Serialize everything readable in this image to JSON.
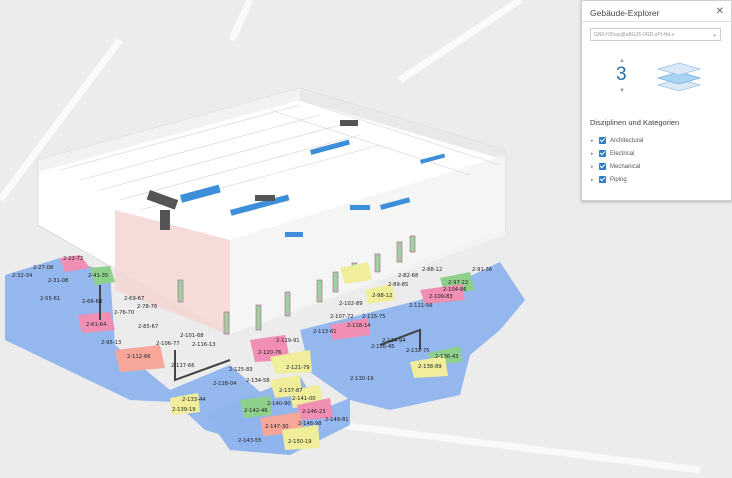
{
  "panel": {
    "title": "Gebäude-Explorer",
    "close_icon": "close-icon",
    "building_select": "GN0-H2hap@aBG35-0GD-zPl-Hd-s",
    "level": "3",
    "level_up_icon": "chevron-up-icon",
    "level_down_icon": "chevron-down-icon",
    "stack_icon": "floor-stack-icon",
    "section_title": "Disziplinen und Kategorien",
    "categories": [
      {
        "label": "Architectural",
        "checked": true
      },
      {
        "label": "Electrical",
        "checked": true
      },
      {
        "label": "Mechanical",
        "checked": true
      },
      {
        "label": "Piping",
        "checked": true
      }
    ]
  },
  "rooms": [
    "2-27-08",
    "2-22-72",
    "2-32-34",
    "2-31-08",
    "2-41-35",
    "2-55-61",
    "2-69-67",
    "2-78-76",
    "2-76-70",
    "2-61-64",
    "2-66-68",
    "2-85-67",
    "2-95-13",
    "2-101-68",
    "2-106-77",
    "2-116-13",
    "2-112-66",
    "2-117-66",
    "2-119-91",
    "2-120-76",
    "2-121-79",
    "2-125-83",
    "2-128-04",
    "2-134-58",
    "2-133-44",
    "2-139-19",
    "2-137-87",
    "2-141-00",
    "2-140-90",
    "2-142-46",
    "2-146-23",
    "2-147-30",
    "2-148-98",
    "2-149-81",
    "2-143-55",
    "2-150-19",
    "2-102-89",
    "2-107-72",
    "2-115-75",
    "2-113-61",
    "2-118-14",
    "2-98-12",
    "2-88-12",
    "2-82-68",
    "2-89-85",
    "2-97-22",
    "2-104-86",
    "2-109-83",
    "2-111-56",
    "2-91-36",
    "2-124-94",
    "2-126-45",
    "2-132-75",
    "2-136-43",
    "2-138-89",
    "2-130-19"
  ],
  "colors": {
    "blue_floor": "#8fb4ee",
    "pink": "#f08fb3",
    "salmon": "#f6a79a",
    "green": "#8fcf8c",
    "yellow": "#f0ee9a",
    "accent": "#2f7dc3"
  }
}
